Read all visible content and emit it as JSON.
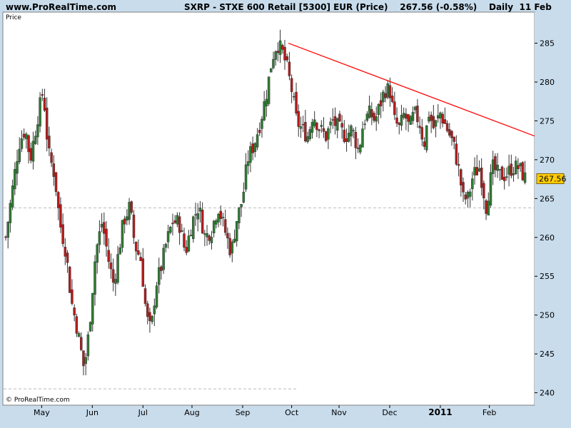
{
  "header": {
    "site": "www.ProRealTime.com",
    "title": "SXRP - STXE 600 Retail [5300] EUR (Price)    267.56 (-0.58%)    Daily  11 Feb"
  },
  "footer": {
    "copyright": "© ProRealTime.com"
  },
  "chart_data": {
    "type": "candlestick",
    "panel_label": "Price",
    "y_ticks": [
      240,
      245,
      250,
      255,
      260,
      265,
      270,
      275,
      280,
      285
    ],
    "ylim": [
      238.4,
      289
    ],
    "x_labels": [
      {
        "label": "May",
        "day": 22
      },
      {
        "label": "Jun",
        "day": 53
      },
      {
        "label": "Jul",
        "day": 84
      },
      {
        "label": "Aug",
        "day": 114
      },
      {
        "label": "Sep",
        "day": 145
      },
      {
        "label": "Oct",
        "day": 175
      },
      {
        "label": "Nov",
        "day": 204
      },
      {
        "label": "Dec",
        "day": 235
      },
      {
        "label": "2011",
        "day": 266,
        "year": true
      },
      {
        "label": "Feb",
        "day": 296
      }
    ],
    "total_days": 318,
    "last_price": 267.56,
    "last_price_label": "267.56",
    "reference_lines": [
      {
        "value": 263.8,
        "style": "dashed",
        "color": "#bbbbbb"
      },
      {
        "value": 240.5,
        "style": "dashed",
        "color": "#bbbbbb",
        "end_day": 178
      }
    ],
    "trendline": {
      "color": "#ff0000",
      "start": {
        "day": 173,
        "value": 285.0
      },
      "end": {
        "day": 318,
        "value": 273.5
      }
    },
    "colors": {
      "up": "#2e7d32",
      "down": "#b71c1c",
      "wick": "#333333",
      "price_tag": "#ffcc00",
      "plot_bg": "#ffffff",
      "frame_bg": "#c8dcec"
    },
    "anchors": [
      [
        0,
        260
      ],
      [
        4,
        266
      ],
      [
        8,
        272
      ],
      [
        12,
        274
      ],
      [
        15,
        270
      ],
      [
        20,
        276
      ],
      [
        23,
        279
      ],
      [
        26,
        271
      ],
      [
        30,
        268
      ],
      [
        33,
        262
      ],
      [
        37,
        258
      ],
      [
        40,
        252
      ],
      [
        44,
        248
      ],
      [
        48,
        243
      ],
      [
        51,
        248
      ],
      [
        55,
        258
      ],
      [
        59,
        262
      ],
      [
        63,
        257
      ],
      [
        66,
        254
      ],
      [
        69,
        258
      ],
      [
        72,
        262
      ],
      [
        76,
        264
      ],
      [
        79,
        259
      ],
      [
        83,
        257
      ],
      [
        85,
        252
      ],
      [
        87,
        249
      ],
      [
        89,
        248
      ],
      [
        92,
        254
      ],
      [
        95,
        256
      ],
      [
        98,
        259
      ],
      [
        102,
        262
      ],
      [
        106,
        262
      ],
      [
        110,
        258
      ],
      [
        114,
        262
      ],
      [
        118,
        264
      ],
      [
        122,
        260
      ],
      [
        126,
        261
      ],
      [
        130,
        264
      ],
      [
        134,
        261
      ],
      [
        138,
        258
      ],
      [
        141,
        262
      ],
      [
        145,
        265
      ],
      [
        148,
        270
      ],
      [
        152,
        272
      ],
      [
        156,
        275
      ],
      [
        160,
        279
      ],
      [
        163,
        283
      ],
      [
        166,
        285
      ],
      [
        169,
        284
      ],
      [
        172,
        282
      ],
      [
        175,
        279
      ],
      [
        178,
        275
      ],
      [
        181,
        274
      ],
      [
        185,
        273
      ],
      [
        188,
        276
      ],
      [
        192,
        274
      ],
      [
        196,
        273
      ],
      [
        200,
        275
      ],
      [
        204,
        274
      ],
      [
        208,
        273
      ],
      [
        212,
        274
      ],
      [
        216,
        271
      ],
      [
        219,
        275
      ],
      [
        223,
        276
      ],
      [
        226,
        275
      ],
      [
        229,
        277
      ],
      [
        232,
        279
      ],
      [
        235,
        279
      ],
      [
        238,
        275
      ],
      [
        241,
        274
      ],
      [
        244,
        276
      ],
      [
        247,
        274
      ],
      [
        250,
        276
      ],
      [
        253,
        275
      ],
      [
        256,
        272
      ],
      [
        259,
        276
      ],
      [
        262,
        274
      ],
      [
        266,
        276
      ],
      [
        270,
        274
      ],
      [
        274,
        272
      ],
      [
        277,
        269
      ],
      [
        280,
        265
      ],
      [
        283,
        265
      ],
      [
        286,
        268
      ],
      [
        290,
        269
      ],
      [
        294,
        264
      ],
      [
        298,
        269
      ],
      [
        302,
        268
      ],
      [
        306,
        268
      ],
      [
        310,
        269
      ],
      [
        314,
        269
      ],
      [
        318,
        267.56
      ]
    ]
  }
}
